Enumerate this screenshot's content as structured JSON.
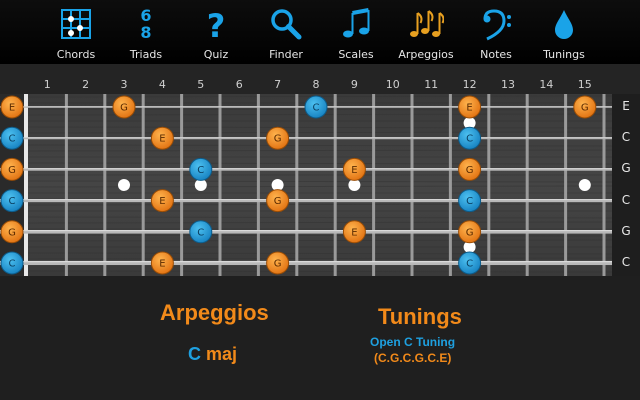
{
  "toolbar": {
    "items": [
      {
        "label": "Chords",
        "icon": "chord-grid-icon"
      },
      {
        "label": "Triads",
        "icon": "triad-icon"
      },
      {
        "label": "Quiz",
        "icon": "question-mark-icon"
      },
      {
        "label": "Finder",
        "icon": "magnifier-icon"
      },
      {
        "label": "Scales",
        "icon": "music-notes-icon"
      },
      {
        "label": "Arpeggios",
        "icon": "triple-notes-icon"
      },
      {
        "label": "Notes",
        "icon": "bass-clef-icon"
      },
      {
        "label": "Tunings",
        "icon": "drop-icon"
      }
    ],
    "active_index": 5
  },
  "fretboard": {
    "fret_numbers": [
      "1",
      "2",
      "3",
      "4",
      "5",
      "6",
      "7",
      "8",
      "9",
      "10",
      "11",
      "12",
      "13",
      "14",
      "15"
    ],
    "string_names": [
      "E",
      "C",
      "G",
      "C",
      "G",
      "C"
    ],
    "inlay_frets": [
      3,
      5,
      7,
      9,
      15
    ],
    "double_inlay_fret": 12,
    "notes": [
      {
        "string": 0,
        "fret": 0,
        "note": "E",
        "kind": "third"
      },
      {
        "string": 0,
        "fret": 3,
        "note": "G",
        "kind": "fifth"
      },
      {
        "string": 0,
        "fret": 8,
        "note": "C",
        "kind": "root"
      },
      {
        "string": 0,
        "fret": 12,
        "note": "E",
        "kind": "third"
      },
      {
        "string": 0,
        "fret": 15,
        "note": "G",
        "kind": "fifth"
      },
      {
        "string": 1,
        "fret": 0,
        "note": "C",
        "kind": "root"
      },
      {
        "string": 1,
        "fret": 4,
        "note": "E",
        "kind": "third"
      },
      {
        "string": 1,
        "fret": 7,
        "note": "G",
        "kind": "fifth"
      },
      {
        "string": 1,
        "fret": 12,
        "note": "C",
        "kind": "root"
      },
      {
        "string": 2,
        "fret": 0,
        "note": "G",
        "kind": "fifth"
      },
      {
        "string": 2,
        "fret": 5,
        "note": "C",
        "kind": "root"
      },
      {
        "string": 2,
        "fret": 9,
        "note": "E",
        "kind": "third"
      },
      {
        "string": 2,
        "fret": 12,
        "note": "G",
        "kind": "fifth"
      },
      {
        "string": 3,
        "fret": 0,
        "note": "C",
        "kind": "root"
      },
      {
        "string": 3,
        "fret": 4,
        "note": "E",
        "kind": "third"
      },
      {
        "string": 3,
        "fret": 7,
        "note": "G",
        "kind": "fifth"
      },
      {
        "string": 3,
        "fret": 12,
        "note": "C",
        "kind": "root"
      },
      {
        "string": 4,
        "fret": 0,
        "note": "G",
        "kind": "fifth"
      },
      {
        "string": 4,
        "fret": 5,
        "note": "C",
        "kind": "root"
      },
      {
        "string": 4,
        "fret": 9,
        "note": "E",
        "kind": "third"
      },
      {
        "string": 4,
        "fret": 12,
        "note": "G",
        "kind": "fifth"
      },
      {
        "string": 5,
        "fret": 0,
        "note": "C",
        "kind": "root"
      },
      {
        "string": 5,
        "fret": 4,
        "note": "E",
        "kind": "third"
      },
      {
        "string": 5,
        "fret": 7,
        "note": "G",
        "kind": "fifth"
      },
      {
        "string": 5,
        "fret": 12,
        "note": "C",
        "kind": "root"
      }
    ]
  },
  "info": {
    "arpeggios_heading": "Arpeggios",
    "chord_root": "C",
    "chord_quality": "maj",
    "tunings_heading": "Tunings",
    "tuning_name": "Open C Tuning",
    "tuning_notes": "(C.G.C.G.C.E)"
  },
  "colors": {
    "accent_orange": "#f28a1a",
    "accent_blue": "#1ea0e0",
    "toolbar_icon": "#1aa3e8",
    "active_icon": "#e8a020",
    "root_marker": "#1a8fd0",
    "other_marker": "#f0891e"
  }
}
